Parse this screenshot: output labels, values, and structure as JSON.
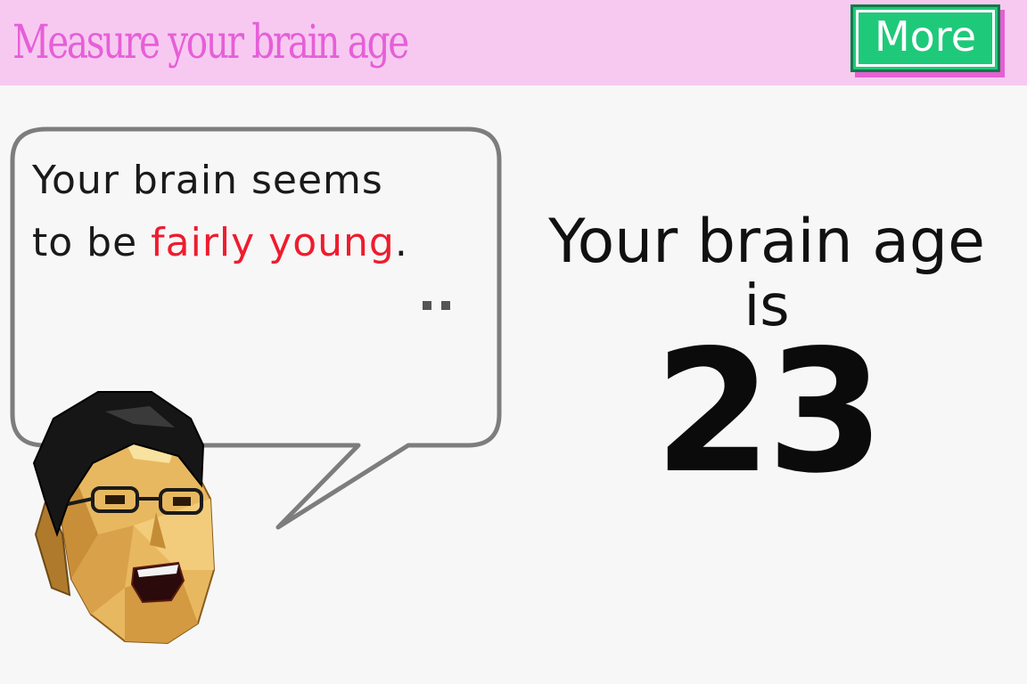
{
  "header": {
    "title": "Measure your brain age",
    "more_button_label": "More"
  },
  "speech_bubble": {
    "line1": "Your brain seems",
    "line2_prefix": "to be ",
    "line2_highlight": "fairly young",
    "line2_suffix": ".",
    "continue_indicator": "••"
  },
  "result": {
    "line1": "Your brain age",
    "line2": "is",
    "brain_age": "23"
  },
  "colors": {
    "header_bg": "#f7c9f1",
    "title_color": "#e65fd8",
    "button_green": "#1fc97a",
    "highlight_red": "#ee1c2e",
    "background": "#f7f7f7"
  },
  "icons": {
    "character": "dr-kawashima-face",
    "continue": "ellipsis-icon"
  }
}
